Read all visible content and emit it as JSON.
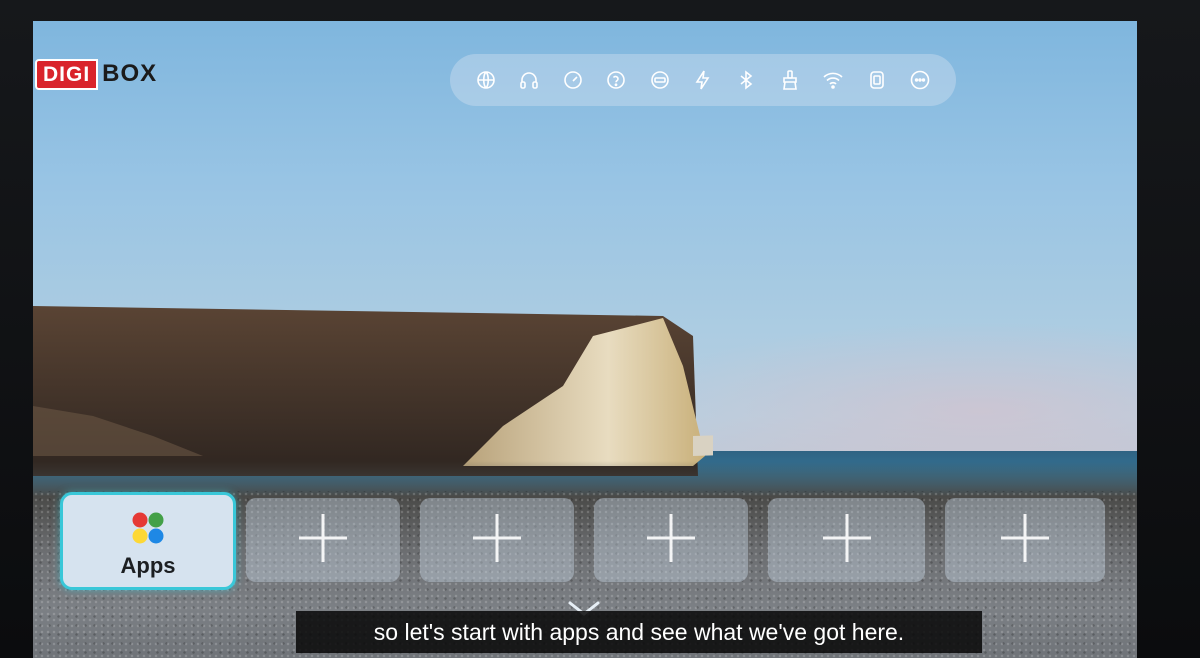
{
  "logo": {
    "part1": "DIGI",
    "part2": "BOX",
    "brand_red": "#d9242b"
  },
  "status_bar": {
    "icons": [
      "network-globe-icon",
      "headset-icon",
      "speedometer-icon",
      "help-icon",
      "hdmi-icon",
      "flash-icon",
      "bluetooth-icon",
      "cleaner-brush-icon",
      "wifi-icon",
      "device-icon",
      "more-icon"
    ]
  },
  "tiles": [
    {
      "label": "Apps",
      "icon": "apps-grid-icon",
      "selected": true
    },
    {
      "icon": "plus-icon"
    },
    {
      "icon": "plus-icon"
    },
    {
      "icon": "plus-icon"
    },
    {
      "icon": "plus-icon"
    },
    {
      "icon": "plus-icon"
    }
  ],
  "accent_color": "#39c7d8",
  "subtitle": "so let's start with apps and see what we've got here."
}
